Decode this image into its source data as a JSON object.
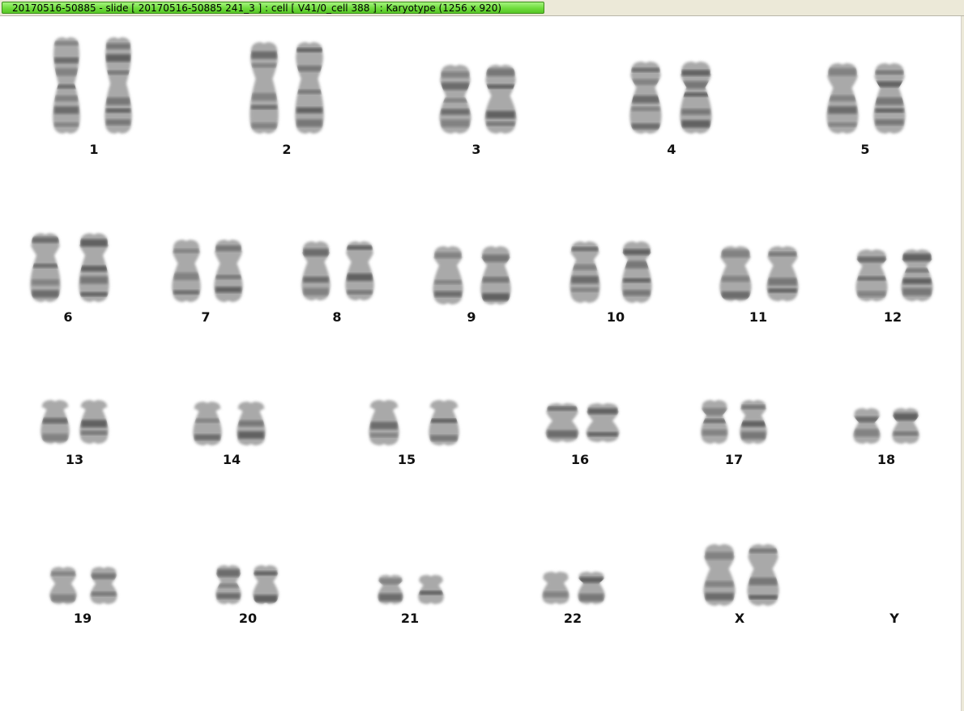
{
  "window": {
    "title": "20170516-50885 - slide [ 20170516-50885 241_3 ] : cell [ V41/0_cell 388 ] : Karyotype  (1256 x 920)"
  },
  "karyotype": {
    "chromosomes": [
      {
        "label": "1",
        "count": 2
      },
      {
        "label": "2",
        "count": 2
      },
      {
        "label": "3",
        "count": 2
      },
      {
        "label": "4",
        "count": 2
      },
      {
        "label": "5",
        "count": 2
      },
      {
        "label": "6",
        "count": 2
      },
      {
        "label": "7",
        "count": 2
      },
      {
        "label": "8",
        "count": 2
      },
      {
        "label": "9",
        "count": 2
      },
      {
        "label": "10",
        "count": 2
      },
      {
        "label": "11",
        "count": 2
      },
      {
        "label": "12",
        "count": 2
      },
      {
        "label": "13",
        "count": 2
      },
      {
        "label": "14",
        "count": 2
      },
      {
        "label": "15",
        "count": 2
      },
      {
        "label": "16",
        "count": 2
      },
      {
        "label": "17",
        "count": 2
      },
      {
        "label": "18",
        "count": 2
      },
      {
        "label": "19",
        "count": 2
      },
      {
        "label": "20",
        "count": 2
      },
      {
        "label": "21",
        "count": 2
      },
      {
        "label": "22",
        "count": 2
      },
      {
        "label": "X",
        "count": 2
      },
      {
        "label": "Y",
        "count": 0
      }
    ]
  }
}
